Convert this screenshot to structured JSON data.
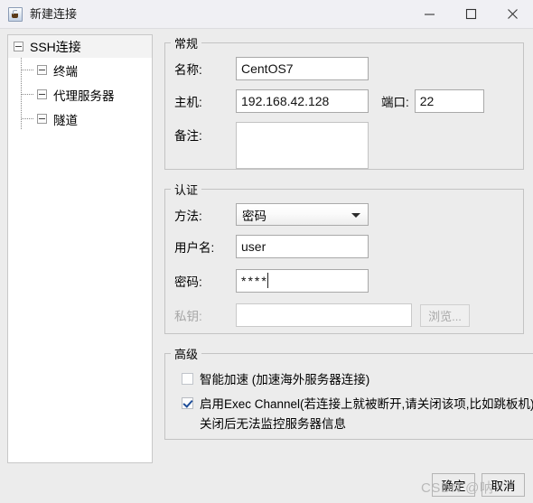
{
  "window": {
    "title": "新建连接",
    "icon": "java-cup-icon",
    "controls": {
      "minimize": "minimize-icon",
      "maximize": "maximize-icon",
      "close": "close-icon"
    }
  },
  "tree": {
    "root": {
      "label": "SSH连接",
      "expander": "minus-box-icon"
    },
    "items": [
      {
        "label": "终端",
        "expander": "minus-box-icon"
      },
      {
        "label": "代理服务器",
        "expander": "minus-box-icon"
      },
      {
        "label": "隧道",
        "expander": "minus-box-icon"
      }
    ]
  },
  "general": {
    "legend": "常规",
    "name_label": "名称:",
    "name_value": "CentOS7",
    "name_placeholder": "",
    "host_label": "主机:",
    "host_value": "192.168.42.128",
    "host_placeholder": "",
    "port_label": "端口:",
    "port_value": "22",
    "port_placeholder": "",
    "note_label": "备注:",
    "note_value": "",
    "note_placeholder": ""
  },
  "auth": {
    "legend": "认证",
    "method_label": "方法:",
    "method_value": "密码",
    "method_options": [
      "密码"
    ],
    "username_label": "用户名:",
    "username_value": "user",
    "username_placeholder": "",
    "password_label": "密码:",
    "password_value": "****",
    "password_placeholder": "",
    "privatekey_label": "私钥:",
    "privatekey_value": "",
    "privatekey_placeholder": "",
    "browse_label": "浏览..."
  },
  "advanced": {
    "legend": "高级",
    "smart_accel_label": "智能加速 (加速海外服务器连接)",
    "smart_accel_checked": false,
    "exec_channel_label": "启用Exec Channel(若连接上就被断开,请关闭该项,比如跳板机)",
    "exec_channel_checked": true,
    "exec_channel_note": "关闭后无法监控服务器信息"
  },
  "buttons": {
    "ok": "确定",
    "cancel": "取消"
  },
  "watermark": {
    "text": "CSDN @呐"
  },
  "colors": {
    "window_bg": "#ececec",
    "titlebar_bg": "#f0f0f4",
    "field_border": "#a9a9a9",
    "group_border": "#c3c3c3",
    "check_accent": "#1f4e99",
    "disabled_text": "#a6a6a6",
    "tree_bg": "#ffffff",
    "tree_root_bg": "#f3f3f3"
  }
}
